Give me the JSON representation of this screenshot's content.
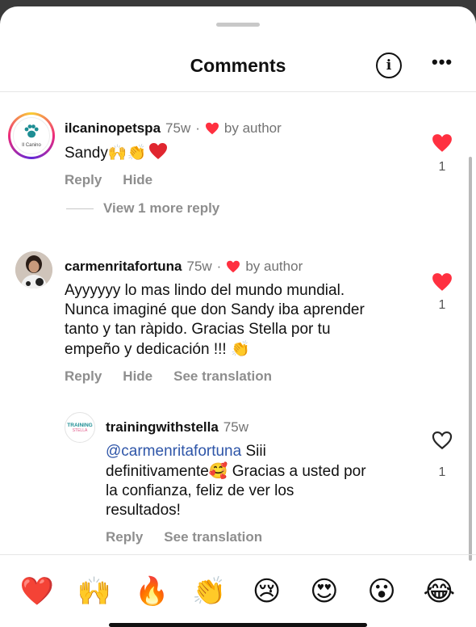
{
  "header": {
    "title": "Comments",
    "info_icon": "i",
    "more_icon": "•••"
  },
  "comments": [
    {
      "username": "ilcaninopetspa",
      "age": "75w",
      "sep": "·",
      "liked_by": "by author",
      "text": "Sandy",
      "text_emojis": "🙌👏",
      "reply_label": "Reply",
      "hide_label": "Hide",
      "like_count": "1",
      "liked": true,
      "avatar_caption": "Il Canino"
    },
    {
      "username": "carmenritafortuna",
      "age": "75w",
      "sep": "·",
      "liked_by": "by author",
      "text_lines": [
        "Ayyyyyy lo mas lindo del mundo mundial.",
        "Nunca imaginé que don Sandy iba aprender",
        "tanto y tan ràpido. Gracias Stella por tu",
        "empeño y dedicación !!!"
      ],
      "text_emoji": "👏",
      "reply_label": "Reply",
      "hide_label": "Hide",
      "translate_label": "See translation",
      "like_count": "1",
      "liked": true
    }
  ],
  "view_more": "View 1 more reply",
  "reply": {
    "username": "trainingwithstella",
    "age": "75w",
    "mention": "@carmenritafortuna",
    "line1_rest": " Siii",
    "line2_a": "definitivamente",
    "line2_emoji": "🥰",
    "line2_b": " Gracias a usted por",
    "line3": "la confianza, feliz de ver los",
    "line4": "resultados!",
    "reply_label": "Reply",
    "translate_label": "See translation",
    "like_count": "1",
    "liked": false,
    "avatar_line1": "TRAINING",
    "avatar_line2": "STELLA"
  },
  "emoji_bar": [
    {
      "name": "heart",
      "glyph": "❤️"
    },
    {
      "name": "raised-hands",
      "glyph": "🙌"
    },
    {
      "name": "fire",
      "glyph": "🔥"
    },
    {
      "name": "clapping-hands",
      "glyph": "👏"
    },
    {
      "name": "crying-face",
      "glyph": "😢"
    },
    {
      "name": "heart-eyes",
      "glyph": "😍"
    },
    {
      "name": "surprised-face",
      "glyph": "😮"
    },
    {
      "name": "tears-of-joy",
      "glyph": "😂"
    }
  ],
  "colors": {
    "like_red": "#ff3040",
    "secondary_text": "#737373",
    "action_gray": "#8e8e8e",
    "mention_blue": "#2e55a8"
  }
}
